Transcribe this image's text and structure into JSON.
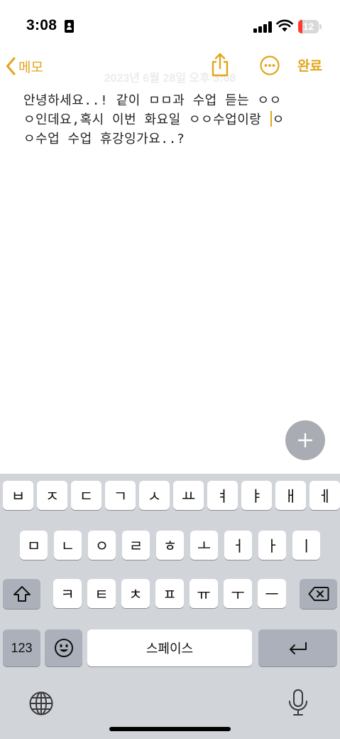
{
  "status_bar": {
    "time": "3:08",
    "battery_level": "12",
    "battery_percent": 12,
    "battery_color": "#ff3b30"
  },
  "nav": {
    "back_label": "메모",
    "date": "2023년 6월 28일 오후 3:08",
    "done_label": "완료",
    "accent_color": "#e3a51a",
    "icons": [
      "chevron-left-icon",
      "share-icon",
      "more-icon"
    ]
  },
  "note": {
    "line1": "안녕하세요..! 같이 ㅁㅁ과 수업 듣는 ㅇㅇ",
    "line2_before_caret": "ㅇ인데요,혹시 이번 화요일 ㅇㅇ수업이랑 ",
    "line2_after_caret": "ㅇ",
    "line3": "ㅇ수업 수업 휴강잉가요..?"
  },
  "add_button": {
    "label": "+"
  },
  "keyboard": {
    "row1": [
      "ㅂ",
      "ㅈ",
      "ㄷ",
      "ㄱ",
      "ㅅ",
      "ㅛ",
      "ㅕ",
      "ㅑ",
      "ㅐ",
      "ㅔ"
    ],
    "row2": [
      "ㅁ",
      "ㄴ",
      "ㅇ",
      "ㄹ",
      "ㅎ",
      "ㅗ",
      "ㅓ",
      "ㅏ",
      "ㅣ"
    ],
    "row3": [
      "ㅋ",
      "ㅌ",
      "ㅊ",
      "ㅍ",
      "ㅠ",
      "ㅜ",
      "ㅡ"
    ],
    "numbers_label": "123",
    "space_label": "스페이스",
    "icons": [
      "shift-icon",
      "delete-icon",
      "emoji-icon",
      "return-icon",
      "globe-icon",
      "microphone-icon"
    ]
  }
}
